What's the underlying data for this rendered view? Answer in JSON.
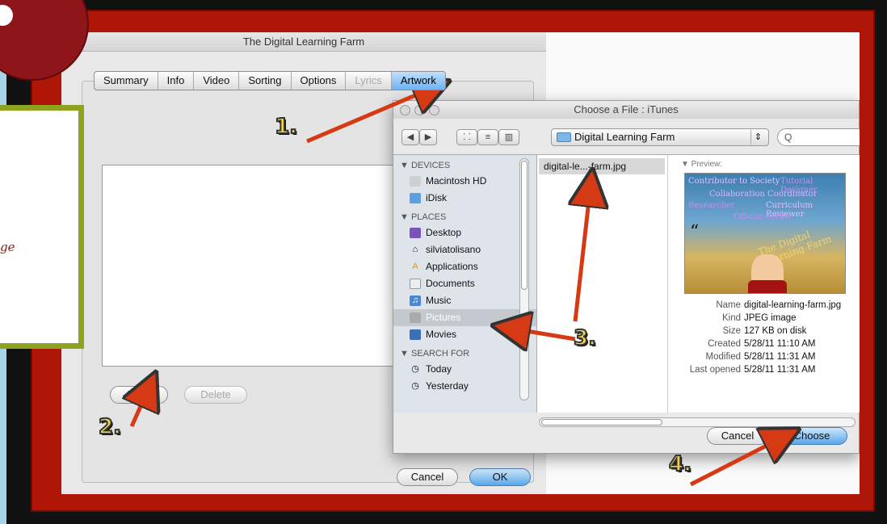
{
  "info_window": {
    "title": "The Digital Learning Farm",
    "tabs": [
      {
        "label": "Summary"
      },
      {
        "label": "Info"
      },
      {
        "label": "Video"
      },
      {
        "label": "Sorting"
      },
      {
        "label": "Options"
      },
      {
        "label": "Lyrics"
      },
      {
        "label": "Artwork"
      }
    ],
    "add_label": "Add...",
    "delete_label": "Delete",
    "cancel_label": "Cancel",
    "ok_label": "OK"
  },
  "dialog": {
    "title": "Choose a File : iTunes",
    "location": "Digital Learning Farm",
    "search_placeholder": "Q",
    "sidebar": {
      "devices_label": "▼ DEVICES",
      "devices": [
        "Macintosh HD",
        "iDisk"
      ],
      "places_label": "▼ PLACES",
      "places": [
        "Desktop",
        "silviatolisano",
        "Applications",
        "Documents",
        "Music",
        "Pictures",
        "Movies"
      ],
      "search_label": "▼ SEARCH FOR",
      "search": [
        "Today",
        "Yesterday"
      ]
    },
    "file": "digital-le...-farm.jpg",
    "preview_label": "▼ Preview:",
    "preview_image_text": [
      "Contributor to Society",
      "Tutorial Designer",
      "Collaboration Coordinator",
      "Researcher",
      "Curriculum Reviewer",
      "Official Scribe",
      "The Digital Learning Farm"
    ],
    "meta": {
      "name_label": "Name",
      "name_value": "digital-learning-farm.jpg",
      "kind_label": "Kind",
      "kind_value": "JPEG image",
      "size_label": "Size",
      "size_value": "127 KB on disk",
      "created_label": "Created",
      "created_value": "5/28/11 11:10 AM",
      "modified_label": "Modified",
      "modified_value": "5/28/11 11:31 AM",
      "opened_label": "Last opened",
      "opened_value": "5/28/11 11:31 AM"
    },
    "cancel_label": "Cancel",
    "choose_label": "Choose"
  },
  "overlay": {
    "callout_text": "ge",
    "steps": [
      "1.",
      "2.",
      "3.",
      "4."
    ]
  },
  "colors": {
    "frame_red": "#b01607",
    "arrow_red": "#d63a14",
    "callout_green": "#8da21e",
    "step_yellow": "#f2d44a"
  }
}
